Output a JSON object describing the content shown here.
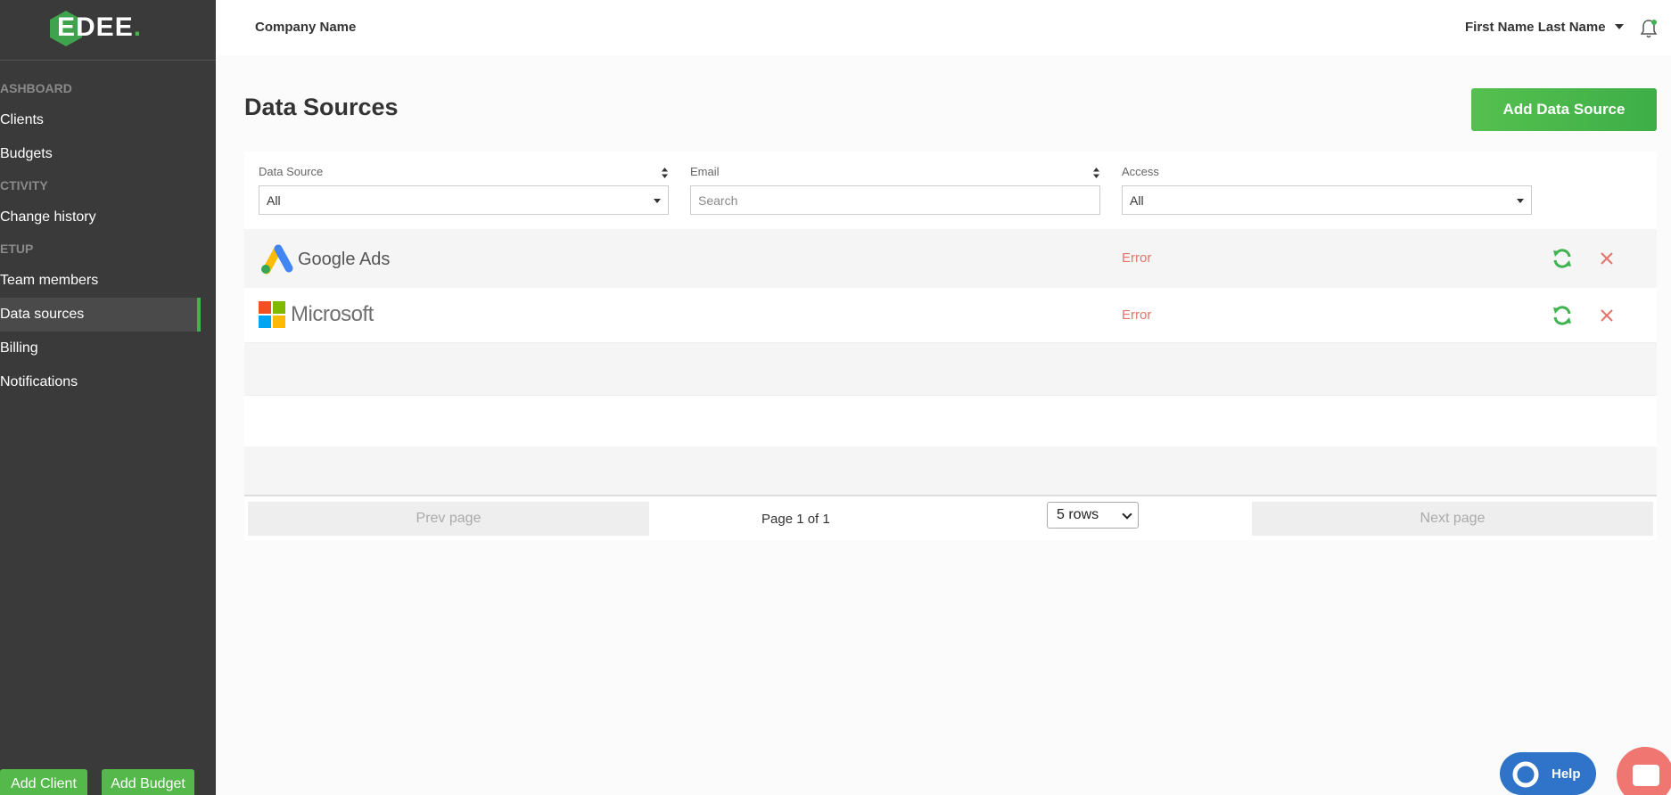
{
  "brand": {
    "logo_letter": "E",
    "logo_rest": "DEE",
    "accent": "#3fb34f"
  },
  "sidebar": {
    "sections": [
      "ASHBOARD",
      "CTIVITY",
      "ETUP"
    ],
    "items": [
      {
        "label": "Clients"
      },
      {
        "label": "Budgets"
      },
      {
        "label": "Change history"
      },
      {
        "label": "Team members"
      },
      {
        "label": "Data sources"
      },
      {
        "label": "Billing"
      },
      {
        "label": "Notifications"
      }
    ],
    "add_client": "Add Client",
    "add_budget": "Add Budget"
  },
  "topbar": {
    "company": "Company Name",
    "user": "First Name Last Name"
  },
  "main": {
    "title": "Data Sources",
    "add_button": "Add Data Source",
    "columns": [
      {
        "label": "Data Source",
        "filter": "All"
      },
      {
        "label": "Email",
        "placeholder": "Search"
      },
      {
        "label": "Access",
        "filter": "All"
      }
    ],
    "rows": [
      {
        "source": "Google Ads",
        "status": "Error"
      },
      {
        "source": "Microsoft",
        "status": "Error"
      }
    ],
    "pager": {
      "prev": "Prev page",
      "info": "Page 1 of 1",
      "rows": "5 rows",
      "next": "Next page"
    }
  },
  "widgets": {
    "help": "Help"
  }
}
